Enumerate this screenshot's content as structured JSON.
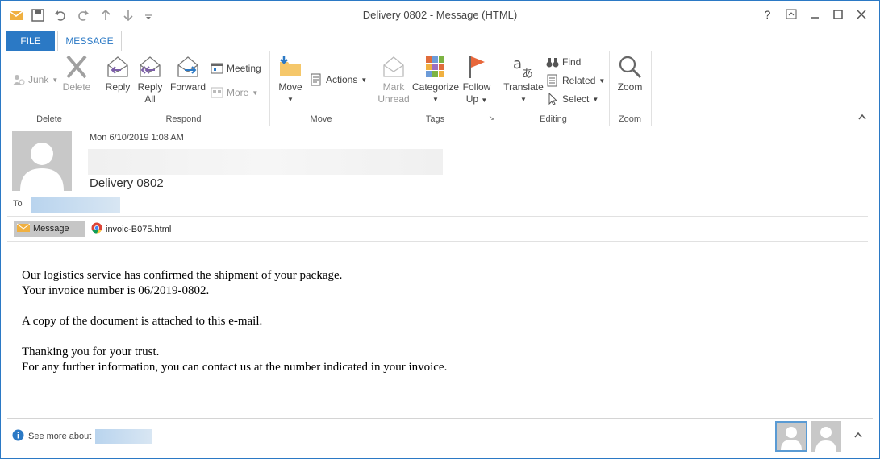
{
  "window": {
    "title": "Delivery 0802 - Message (HTML)"
  },
  "tabs": {
    "file": "FILE",
    "message": "MESSAGE"
  },
  "window_controls": {
    "help": "?"
  },
  "ribbon": {
    "delete_group": {
      "label": "Delete",
      "junk": "Junk",
      "delete": "Delete"
    },
    "respond_group": {
      "label": "Respond",
      "reply": "Reply",
      "reply_all_1": "Reply",
      "reply_all_2": "All",
      "forward": "Forward",
      "meeting": "Meeting",
      "more": "More"
    },
    "move_group": {
      "label": "Move",
      "move": "Move",
      "actions": "Actions"
    },
    "tags_group": {
      "label": "Tags",
      "mark_unread_1": "Mark",
      "mark_unread_2": "Unread",
      "categorize": "Categorize",
      "follow_up_1": "Follow",
      "follow_up_2": "Up"
    },
    "editing_group": {
      "label": "Editing",
      "translate": "Translate",
      "find": "Find",
      "related": "Related",
      "select": "Select"
    },
    "zoom_group": {
      "label": "Zoom",
      "zoom": "Zoom"
    }
  },
  "message": {
    "date": "Mon 6/10/2019 1:08 AM",
    "subject": "Delivery 0802",
    "to_label": "To",
    "attachments": [
      {
        "label": "Message",
        "icon": "envelope-icon"
      },
      {
        "label": "invoic-B075.html",
        "icon": "chrome-icon"
      }
    ],
    "body": [
      "Our logistics service has confirmed the shipment of your package.",
      "Your invoice number is 06/2019-0802.",
      "",
      "A copy of the document is attached to this e-mail.",
      "",
      "Thanking you for your trust.",
      "For any further information, you can contact us at the number indicated in your invoice."
    ]
  },
  "footer": {
    "see_more": "See more about"
  },
  "colors": {
    "accent": "#2b79c5",
    "file_tab": "#2b79c5"
  }
}
